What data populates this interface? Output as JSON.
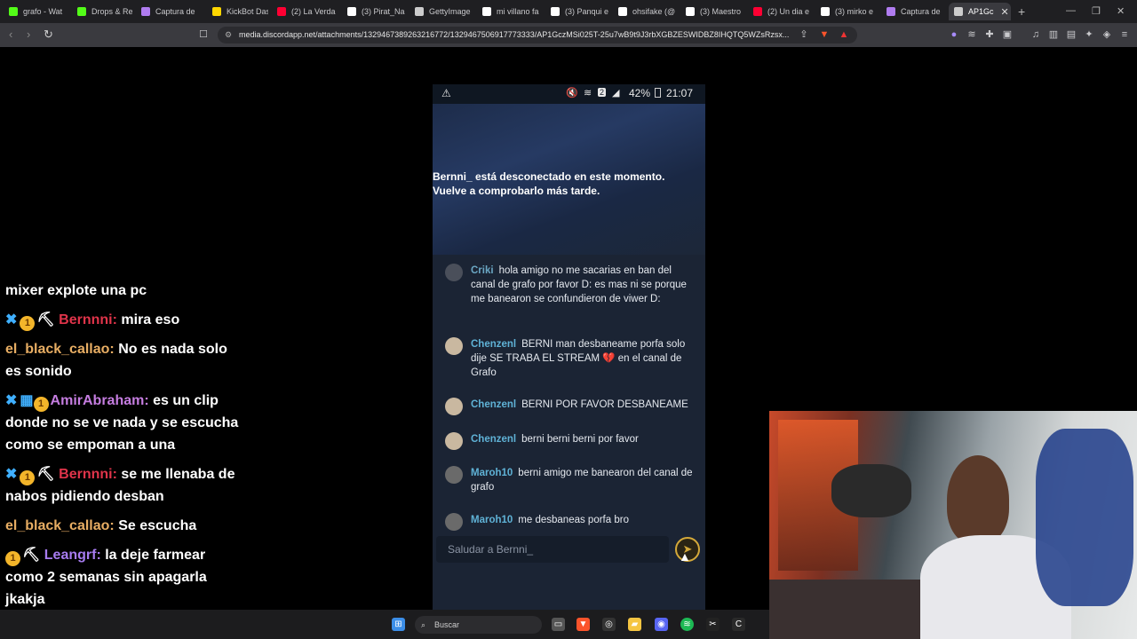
{
  "browser": {
    "tabs": [
      {
        "label": "grafo - Wat",
        "icon": "kick-icon",
        "color": "#53fc18"
      },
      {
        "label": "Drops & Re",
        "icon": "kick-icon",
        "color": "#53fc18"
      },
      {
        "label": "Captura de",
        "icon": "snip-icon",
        "color": "#b07cf0"
      },
      {
        "label": "KickBot Das",
        "icon": "kickbot-icon",
        "color": "#ffd700"
      },
      {
        "label": "(2) La Verda",
        "icon": "youtube-icon",
        "color": "#ff0033"
      },
      {
        "label": "(3) Pirat_Na",
        "icon": "x-icon",
        "color": "#ffffff"
      },
      {
        "label": "GettyImage",
        "icon": "globe-icon",
        "color": "#cccccc"
      },
      {
        "label": "mi villano fa",
        "icon": "google-icon",
        "color": "#ffffff"
      },
      {
        "label": "(3) Panqui e",
        "icon": "x-icon",
        "color": "#ffffff"
      },
      {
        "label": "ohsifake (@",
        "icon": "tiktok-icon",
        "color": "#ffffff"
      },
      {
        "label": "(3) Maestro",
        "icon": "x-icon",
        "color": "#ffffff"
      },
      {
        "label": "(2) Un dia e",
        "icon": "youtube-icon",
        "color": "#ff0033"
      },
      {
        "label": "(3) mirko e",
        "icon": "x-icon",
        "color": "#ffffff"
      },
      {
        "label": "Captura de",
        "icon": "snip-icon",
        "color": "#b07cf0"
      },
      {
        "label": "AP1Gc",
        "icon": "globe-icon",
        "color": "#cccccc",
        "active": true
      }
    ],
    "url": "media.discordapp.net/attachments/1329467389263216772/1329467506917773333/AP1GczMSi025T-25u7wB9t9J3rbXGBZESWIDBZ8IHQTQ5WZsRzsx..."
  },
  "phone": {
    "status": {
      "battery": "42%",
      "time": "21:07",
      "sim": "2"
    },
    "offline_line1": "Bernni_ está desconectado en este momento.",
    "offline_line2": "Vuelve a comprobarlo más tarde.",
    "messages": [
      {
        "user": "Criki",
        "text": "hola amigo no me sacarias en ban del canal de grafo por favor D: es mas ni se porque me banearon se confundieron de viwer D:"
      },
      {
        "user": "Chenzenl",
        "text": "BERNI man desbaneame porfa solo dije SE TRABA EL STREAM 💔 en el canal de Grafo"
      },
      {
        "user": "Chenzenl",
        "text": "BERNI POR FAVOR DESBANEAME"
      },
      {
        "user": "Chenzenl",
        "text": "berni berni berni por favor"
      },
      {
        "user": "Maroh10",
        "text": "berni amigo me banearon del canal de grafo"
      },
      {
        "user": "Maroh10",
        "text": "me desbaneas porfa bro"
      }
    ],
    "input_placeholder": "Saludar a Bernni_"
  },
  "stream_chat": [
    {
      "badges": "",
      "user": "",
      "text": "mixer explote una pc"
    },
    {
      "badges": "sword,1,pick",
      "user": "Bernnni:",
      "color": "u1",
      "text": "mira eso"
    },
    {
      "badges": "",
      "user": "el_black_callao:",
      "color": "u2",
      "text": "No es nada solo es sonido"
    },
    {
      "badges": "sword,sub,1",
      "user": "AmirAbraham:",
      "color": "u3",
      "text": "es un clip donde no se ve nada y se escucha como se empoman a una"
    },
    {
      "badges": "sword,1,pick",
      "user": "Bernnni:",
      "color": "u1",
      "text": "se me llenaba de nabos pidiendo desban"
    },
    {
      "badges": "",
      "user": "el_black_callao:",
      "color": "u2",
      "text": "Se escucha"
    },
    {
      "badges": "1,pick",
      "user": "Leangrf:",
      "color": "u4",
      "text": "la deje farmear como 2 semanas sin apagarla jkakja"
    }
  ],
  "taskbar": {
    "search": "Buscar"
  }
}
